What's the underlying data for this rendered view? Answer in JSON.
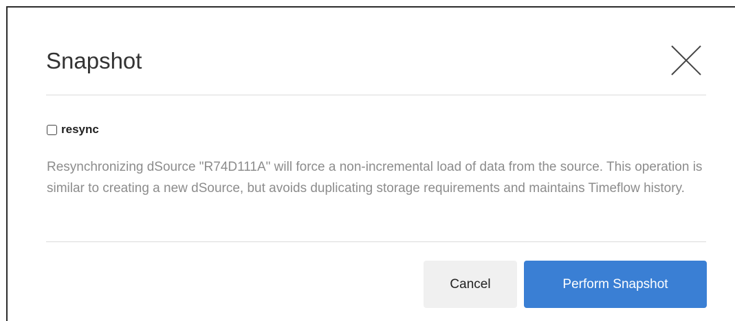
{
  "dialog": {
    "title": "Snapshot",
    "close_icon": "close-x-icon",
    "resync": {
      "label": "resync",
      "checked": false,
      "description": "Resynchronizing dSource \"R74D111A\" will force a non-incremental load of data from the source. This operation is similar to creating a new dSource, but avoids duplicating storage requirements and maintains Timeflow history."
    },
    "buttons": {
      "cancel_label": "Cancel",
      "primary_label": "Perform Snapshot"
    }
  },
  "colors": {
    "primary_button": "#3a7fd4",
    "cancel_button": "#f0f0f0",
    "description_text": "#8c8c8c",
    "title_text": "#333333"
  }
}
